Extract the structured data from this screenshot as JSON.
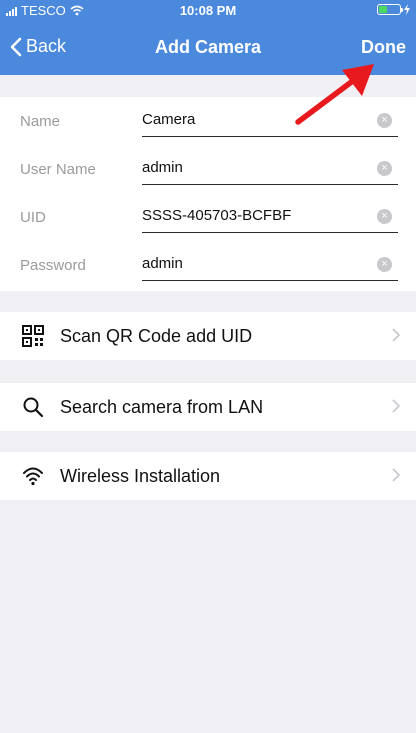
{
  "status_bar": {
    "carrier": "TESCO",
    "time": "10:08 PM"
  },
  "nav": {
    "back_label": "Back",
    "title": "Add Camera",
    "done_label": "Done"
  },
  "form": {
    "fields": [
      {
        "label": "Name",
        "value": "Camera"
      },
      {
        "label": "User Name",
        "value": "admin"
      },
      {
        "label": "UID",
        "value": "SSSS-405703-BCFBF"
      },
      {
        "label": "Password",
        "value": "admin"
      }
    ],
    "clear_glyph": "×"
  },
  "actions": [
    {
      "label": "Scan QR Code add UID",
      "icon": "qr-code-icon"
    },
    {
      "label": "Search camera from LAN",
      "icon": "search-icon"
    },
    {
      "label": "Wireless Installation",
      "icon": "wifi-icon"
    }
  ],
  "colors": {
    "accent": "#4a89dc",
    "background": "#efeff4",
    "annotation_arrow": "#e8191c"
  }
}
